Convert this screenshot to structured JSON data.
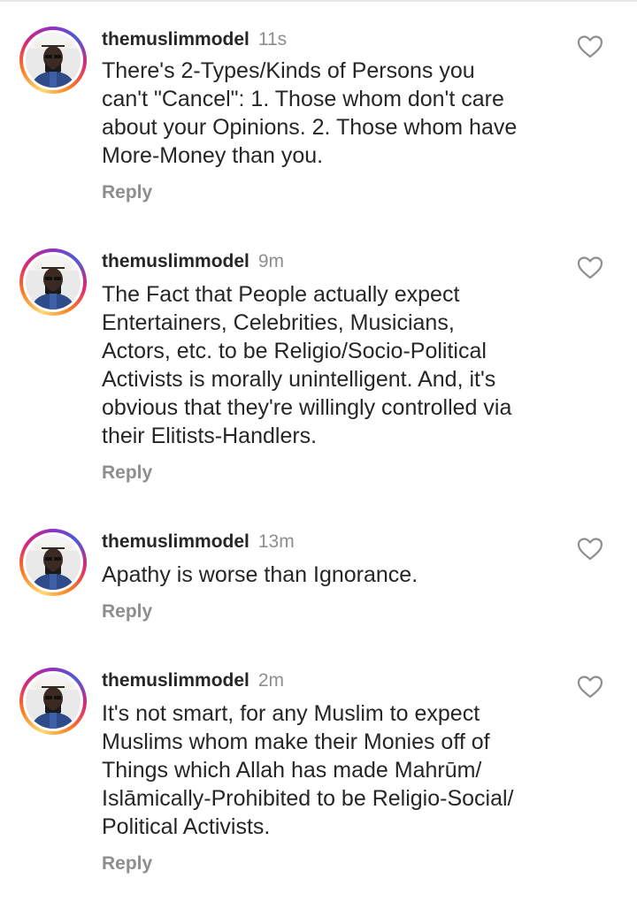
{
  "comments": [
    {
      "username": "themuslimmodel",
      "time": "11s",
      "text_lines": [
        "There's 2-Types/Kinds of Persons you",
        "can't \"Cancel\": 1. Those whom don't care",
        "about your Opinions. 2. Those whom have",
        "More-Money than you."
      ],
      "reply_label": "Reply",
      "icon": "heart-outline-icon"
    },
    {
      "username": "themuslimmodel",
      "time": "9m",
      "text_lines": [
        "The Fact that People actually expect",
        "Entertainers, Celebrities, Musicians,",
        "Actors, etc. to be Religio/Socio-Political",
        "Activists is morally unintelligent. And, it's",
        "obvious that they're willingly controlled via",
        "their Elitists-Handlers."
      ],
      "reply_label": "Reply",
      "icon": "heart-outline-icon"
    },
    {
      "username": "themuslimmodel",
      "time": "13m",
      "text_lines": [
        "Apathy is worse than Ignorance."
      ],
      "reply_label": "Reply",
      "icon": "heart-outline-icon"
    },
    {
      "username": "themuslimmodel",
      "time": "2m",
      "text_lines": [
        "It's not smart, for any Muslim to expect",
        "Muslims whom make their Monies off of",
        "Things which Allah has made Mahrūm/",
        "Islāmically-Prohibited to be Religio-Social/",
        "Political Activists."
      ],
      "reply_label": "Reply",
      "icon": "heart-outline-icon"
    }
  ],
  "colors": {
    "text": "#262626",
    "muted": "#8e8e8e",
    "story_ring": [
      "#feda75",
      "#fa7e1e",
      "#d62976",
      "#962fbf",
      "#4f5bd5"
    ]
  }
}
